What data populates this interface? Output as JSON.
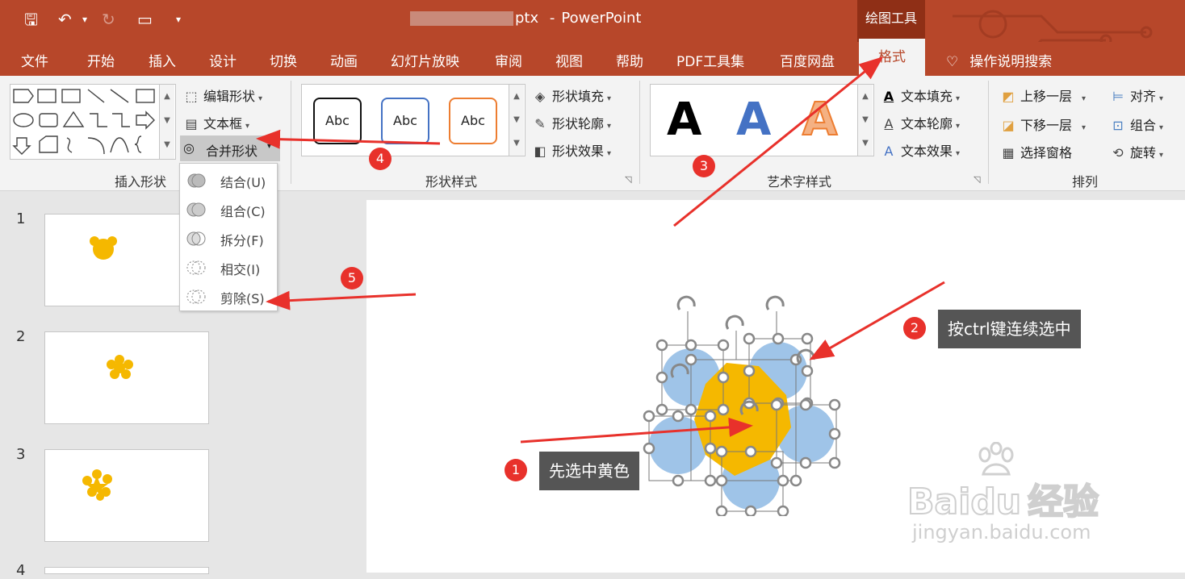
{
  "titlebar": {
    "doc_suffix": "ptx",
    "separator": "-",
    "app_name": "PowerPoint",
    "contextual_tab_group": "绘图工具",
    "qa_save": "🖫",
    "qa_undo": "↶",
    "qa_undo_caret": "▾",
    "qa_redo": "↻",
    "qa_present": "▭",
    "qa_customize": "▾"
  },
  "tabs": [
    "文件",
    "开始",
    "插入",
    "设计",
    "切换",
    "动画",
    "幻灯片放映",
    "审阅",
    "视图",
    "帮助",
    "PDF工具集",
    "百度网盘"
  ],
  "active_tab": "格式",
  "help_search": "操作说明搜索",
  "ribbon": {
    "insert_shapes": {
      "label": "插入形状",
      "edit_shape": "编辑形状",
      "text_box": "文本框",
      "merge_shapes": "合并形状"
    },
    "shape_styles": {
      "label": "形状样式",
      "samples": [
        "Abc",
        "Abc",
        "Abc"
      ],
      "fill": "形状填充",
      "outline": "形状轮廓",
      "effects": "形状效果"
    },
    "wordart_styles": {
      "label": "艺术字样式",
      "samples": [
        "A",
        "A",
        "A"
      ],
      "fill": "文本填充",
      "outline": "文本轮廓",
      "effects": "文本效果"
    },
    "arrange": {
      "label": "排列",
      "bring_forward": "上移一层",
      "send_backward": "下移一层",
      "selection_pane": "选择窗格",
      "align": "对齐",
      "group": "组合",
      "rotate": "旋转"
    }
  },
  "merge_menu": [
    {
      "label": "结合(U)"
    },
    {
      "label": "组合(C)"
    },
    {
      "label": "拆分(F)"
    },
    {
      "label": "相交(I)"
    },
    {
      "label": "剪除(S)"
    }
  ],
  "slides": [
    "1",
    "2",
    "3",
    "4"
  ],
  "annotations": {
    "step1": {
      "num": "1",
      "text": "先选中黄色"
    },
    "step2": {
      "num": "2",
      "text": "按ctrl键连续选中"
    },
    "step3": {
      "num": "3"
    },
    "step4": {
      "num": "4"
    },
    "step5": {
      "num": "5"
    }
  },
  "watermark": {
    "brand": "Bai",
    "brand_du": "du",
    "brand_cn": "经验",
    "url": "jingyan.baidu.com"
  },
  "colors": {
    "title_bar": "#b7472a",
    "accent_yellow": "#f5b800",
    "circle_blue": "#9fc4e8",
    "annotation_red": "#e8312b"
  }
}
